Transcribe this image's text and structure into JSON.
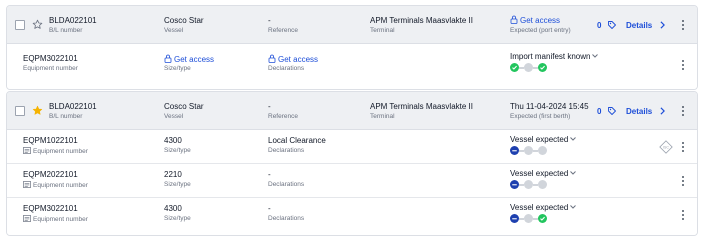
{
  "shipment1": {
    "bl_number": "BLDA022101",
    "bl_label": "B/L number",
    "vessel": "Cosco Star",
    "vessel_label": "Vessel",
    "reference": "-",
    "reference_label": "Reference",
    "terminal": "APM Terminals Maasvlakte II",
    "terminal_label": "Terminal",
    "expected": "Get access",
    "expected_label": "Expected (port entry)",
    "count": "0",
    "details_label": "Details",
    "starred": false,
    "containers": [
      {
        "equipment_number": "EQPM3022101",
        "equipment_label": "Equipment number",
        "size": "Get access",
        "size_label": "Size/type",
        "declarations": "Get access",
        "declarations_label": "Declarations",
        "status": "Import manifest known",
        "steps": [
          "done",
          "pending",
          "done"
        ]
      }
    ]
  },
  "shipment2": {
    "bl_number": "BLDA022101",
    "bl_label": "B/L number",
    "vessel": "Cosco Star",
    "vessel_label": "Vessel",
    "reference": "-",
    "reference_label": "Reference",
    "terminal": "APM Terminals Maasvlakte II",
    "terminal_label": "Terminal",
    "expected": "Thu 11-04-2024 15:45",
    "expected_label": "Expected (first berth)",
    "count": "0",
    "details_label": "Details",
    "starred": true,
    "containers": [
      {
        "equipment_number": "EQPM1022101",
        "equipment_label": "Equipment number",
        "size": "4300",
        "size_label": "Size/type",
        "declarations": "Local Clearance",
        "declarations_label": "Declarations",
        "status": "Vessel expected",
        "steps": [
          "active",
          "pending",
          "pending"
        ]
      },
      {
        "equipment_number": "EQPM2022101",
        "equipment_label": "Equipment number",
        "size": "2210",
        "size_label": "Size/type",
        "declarations": "-",
        "declarations_label": "Declarations",
        "status": "Vessel expected",
        "steps": [
          "active",
          "pending",
          "pending"
        ]
      },
      {
        "equipment_number": "EQPM3022101",
        "equipment_label": "Equipment number",
        "size": "4300",
        "size_label": "Size/type",
        "declarations": "-",
        "declarations_label": "Declarations",
        "status": "Vessel expected",
        "steps": [
          "active",
          "pending",
          "done"
        ]
      }
    ]
  },
  "colors": {
    "accent": "#1d4ed8",
    "done": "#22c55e",
    "active": "#1e40af",
    "pending": "#d1d5db",
    "star": "#f5b301"
  },
  "icons": {
    "star": "star-icon",
    "lock": "lock-icon",
    "tag": "tag-icon",
    "chevron": "chevron-right-icon",
    "menu": "more-vertical-icon",
    "doc": "document-icon",
    "badge": "diamond-badge-icon"
  }
}
